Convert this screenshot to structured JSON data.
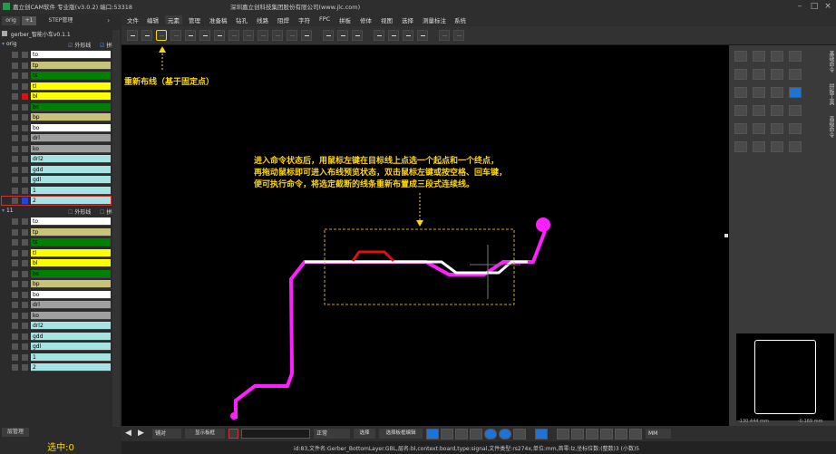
{
  "titlebar": {
    "app_title": "嘉立创CAM软件 专业版(v3.0.2) 端口:53318",
    "company": "深圳嘉立创科技集团股份有限公司(www.jlc.com)"
  },
  "menu": [
    "文件",
    "编辑",
    "元素",
    "管理",
    "准备稿",
    "钻孔",
    "线路",
    "阻焊",
    "字符",
    "FPC",
    "拼板",
    "修体",
    "视图",
    "选择",
    "测量标注",
    "系统"
  ],
  "left_panel": {
    "tabs": [
      "orig",
      "+1",
      "STEP管理"
    ],
    "job_name": "gerber_智能小车v0.1.1",
    "group1": {
      "name": "orig",
      "outline_label": "外形线",
      "panel_label": "拼板"
    },
    "group2": {
      "name": "11",
      "outline_label": "外形线",
      "panel_label": "拼板"
    },
    "layers1": [
      {
        "name": "to",
        "color": "#ffffff"
      },
      {
        "name": "tp",
        "color": "#c9c37a"
      },
      {
        "name": "ts",
        "color": "#008000"
      },
      {
        "name": "tl",
        "color": "#ffff00"
      },
      {
        "name": "bl",
        "color": "#ffff00"
      },
      {
        "name": "bs",
        "color": "#008000"
      },
      {
        "name": "bp",
        "color": "#c9c37a"
      },
      {
        "name": "bo",
        "color": "#ffffff"
      },
      {
        "name": "drl",
        "color": "#a0a0a0"
      },
      {
        "name": "ko",
        "color": "#a0a0a0"
      },
      {
        "name": "drl2",
        "color": "#a6e3e3"
      },
      {
        "name": "gdd",
        "color": "#a6e3e3"
      },
      {
        "name": "gdl",
        "color": "#a6e3e3"
      },
      {
        "name": "1",
        "color": "#a6e3e3"
      },
      {
        "name": "2",
        "color": "#a6e3e3"
      }
    ],
    "layers2": [
      {
        "name": "to",
        "color": "#ffffff"
      },
      {
        "name": "tp",
        "color": "#c9c37a"
      },
      {
        "name": "ts",
        "color": "#008000"
      },
      {
        "name": "tl",
        "color": "#ffff00"
      },
      {
        "name": "bl",
        "color": "#ffff00"
      },
      {
        "name": "bs",
        "color": "#008000"
      },
      {
        "name": "bp",
        "color": "#c9c37a"
      },
      {
        "name": "bo",
        "color": "#ffffff"
      },
      {
        "name": "drl",
        "color": "#a0a0a0"
      },
      {
        "name": "ko",
        "color": "#a0a0a0"
      },
      {
        "name": "drl2",
        "color": "#a6e3e3"
      },
      {
        "name": "gdd",
        "color": "#a6e3e3"
      },
      {
        "name": "gdl",
        "color": "#a6e3e3"
      },
      {
        "name": "1",
        "color": "#a6e3e3"
      },
      {
        "name": "2",
        "color": "#a6e3e3"
      }
    ],
    "bottom_tab": "层管理",
    "selected_count": "选中:0"
  },
  "canvas": {
    "tool_label": "重新布线（基于固定点）",
    "instruction_lines": [
      "进入命令状态后，用鼠标左键在目标线上点选一个起点和一个终点，",
      "再拖动鼠标即可进入布线预览状态，双击鼠标左键或按空格、回车键，",
      "便可执行命令，将选定截断的线条重新布置成三段式连续线。"
    ]
  },
  "right_panel": {
    "tabs": [
      "基础命令",
      "拼板工具",
      "高级命令"
    ],
    "coords": "-130.444 mm",
    "coords2": "-0.169 mm"
  },
  "bottombar": {
    "zoom_option": "铺对",
    "fit_label": "显示板框",
    "mode_value": "正常",
    "filter_label": "选择",
    "show_label": "选择板框编辑",
    "unit_value": "MM"
  },
  "statusbar": {
    "text": "id:83,文件名:Gerber_BottomLayer.GBL,层名:bl,context:board,type:signal,文件类型:rs274x,单位:mm,首零:lz,坐标位数:(整数)3 (小数)5"
  },
  "colors": {
    "accent_yellow": "#ffd700",
    "trace_magenta": "#ff1fff",
    "trace_red": "#e01010",
    "select_blue": "#1e73d6"
  }
}
